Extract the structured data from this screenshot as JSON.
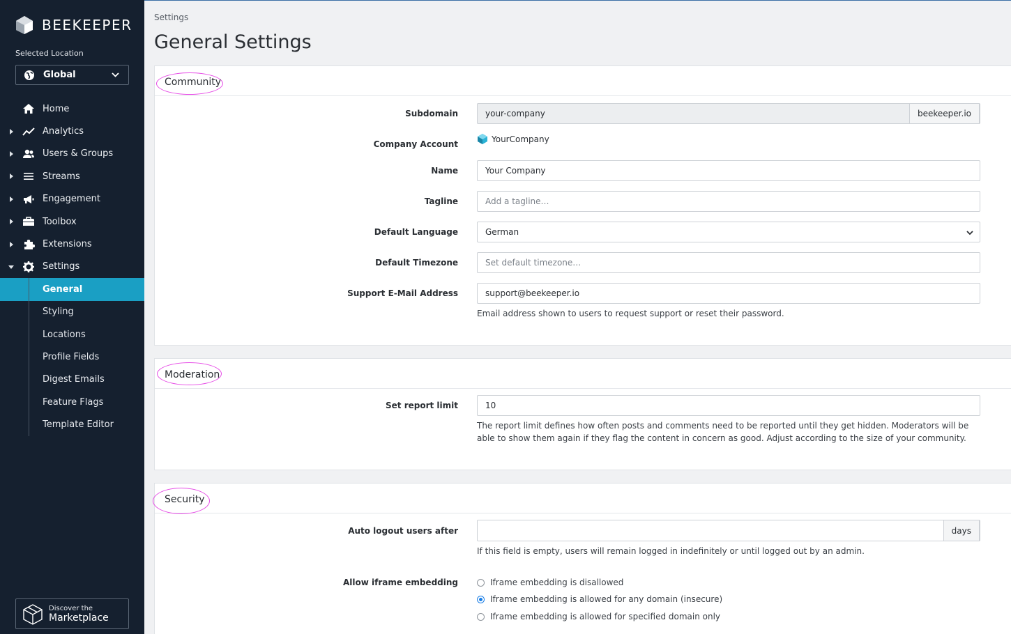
{
  "brand": {
    "name": "BEEKEEPER"
  },
  "location": {
    "label": "Selected Location",
    "value": "Global"
  },
  "nav": [
    {
      "label": "Home",
      "icon": "home-icon",
      "caret": false
    },
    {
      "label": "Analytics",
      "icon": "chart-line-icon",
      "caret": true
    },
    {
      "label": "Users & Groups",
      "icon": "users-icon",
      "caret": true
    },
    {
      "label": "Streams",
      "icon": "bars-icon",
      "caret": true
    },
    {
      "label": "Engagement",
      "icon": "megaphone-icon",
      "caret": true
    },
    {
      "label": "Toolbox",
      "icon": "toolbox-icon",
      "caret": true
    },
    {
      "label": "Extensions",
      "icon": "puzzle-icon",
      "caret": true
    },
    {
      "label": "Settings",
      "icon": "gear-icon",
      "caret": true,
      "expanded": true
    }
  ],
  "settings_sub": [
    "General",
    "Styling",
    "Locations",
    "Profile Fields",
    "Digest Emails",
    "Feature Flags",
    "Template Editor"
  ],
  "marketplace": {
    "line1": "Discover the",
    "line2": "Marketplace"
  },
  "page": {
    "breadcrumb": "Settings",
    "title": "General Settings"
  },
  "community": {
    "title": "Community",
    "subdomain_label": "Subdomain",
    "subdomain_value": "your-company",
    "subdomain_suffix": "beekeeper.io",
    "account_label": "Company Account",
    "account_value": "YourCompany",
    "name_label": "Name",
    "name_value": "Your Company",
    "tagline_label": "Tagline",
    "tagline_placeholder": "Add a tagline…",
    "language_label": "Default Language",
    "language_value": "German",
    "timezone_label": "Default Timezone",
    "timezone_placeholder": "Set default timezone…",
    "email_label": "Support E-Mail Address",
    "email_value": "support@beekeeper.io",
    "email_help": "Email address shown to users to request support or reset their password."
  },
  "moderation": {
    "title": "Moderation",
    "report_label": "Set report limit",
    "report_value": "10",
    "report_help": "The report limit defines how often posts and comments need to be reported until they get hidden. Moderators will be able to show them again if they flag the content in concern as good. Adjust according to the size of your community."
  },
  "security": {
    "title": "Security",
    "logout_label": "Auto logout users after",
    "logout_suffix": "days",
    "logout_help": "If this field is empty, users will remain logged in indefinitely or until logged out by an admin.",
    "iframe_label": "Allow iframe embedding",
    "iframe_options": [
      "Iframe embedding is disallowed",
      "Iframe embedding is allowed for any domain (insecure)",
      "Iframe embedding is allowed for specified domain only"
    ],
    "iframe_selected": 1
  },
  "colors": {
    "sidebar": "#15202f",
    "active": "#1a9fc4",
    "highlight_ring": "#e64be6",
    "radio": "#1a7ee6"
  }
}
